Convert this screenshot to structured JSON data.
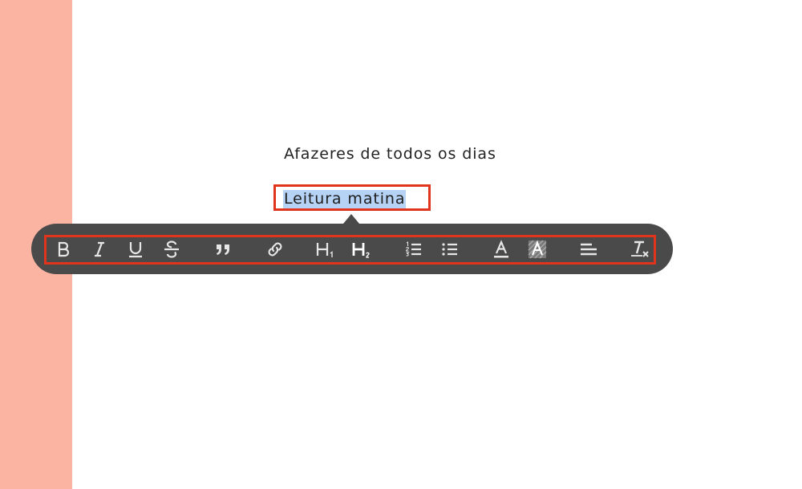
{
  "document": {
    "heading": "Afazeres de todos os dias",
    "selected_text": "Leitura matina"
  },
  "toolbar": {
    "buttons": [
      {
        "name": "bold",
        "icon": "bold-icon"
      },
      {
        "name": "italic",
        "icon": "italic-icon"
      },
      {
        "name": "underline",
        "icon": "underline-icon"
      },
      {
        "name": "strikethrough",
        "icon": "strikethrough-icon"
      },
      {
        "name": "quote",
        "icon": "quote-icon"
      },
      {
        "name": "link",
        "icon": "link-icon"
      },
      {
        "name": "heading-1",
        "icon": "heading-1-icon"
      },
      {
        "name": "heading-2",
        "icon": "heading-2-icon"
      },
      {
        "name": "ordered-list",
        "icon": "ordered-list-icon"
      },
      {
        "name": "bullet-list",
        "icon": "bullet-list-icon"
      },
      {
        "name": "text-color",
        "icon": "text-color-icon"
      },
      {
        "name": "highlight",
        "icon": "highlight-icon"
      },
      {
        "name": "align",
        "icon": "align-icon"
      },
      {
        "name": "clear-format",
        "icon": "clear-format-icon"
      }
    ]
  },
  "colors": {
    "sidebar": "#fbb4a2",
    "toolbar": "#4a4a4a",
    "icon": "#e6e6e6",
    "annotation": "#e0341d",
    "selection": "#b6d3f5"
  }
}
